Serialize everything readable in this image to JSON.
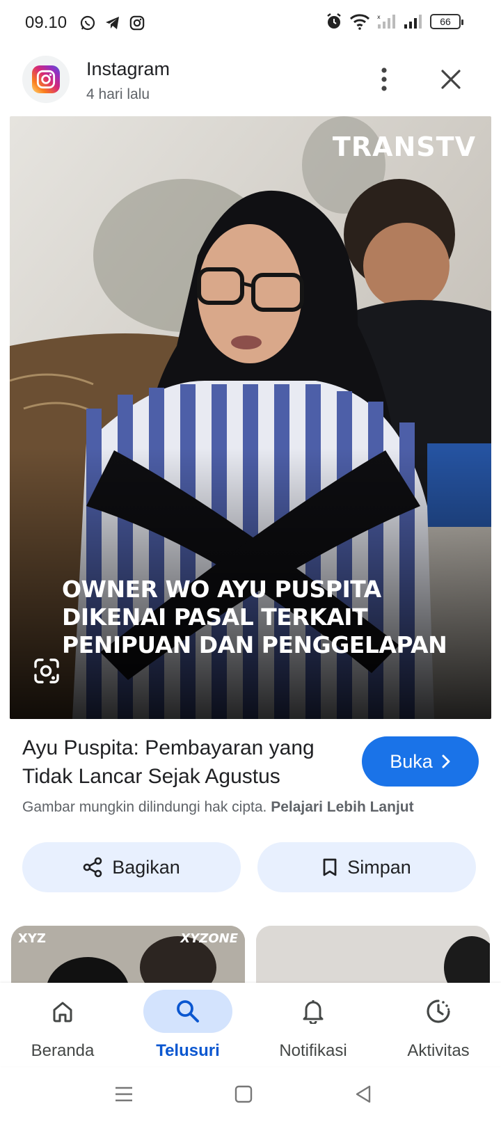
{
  "status_bar": {
    "time": "09.10",
    "battery": "66",
    "left_icons": [
      "whatsapp-icon",
      "telegram-icon",
      "instagram-icon"
    ],
    "right_icons": [
      "alarm-icon",
      "wifi-icon",
      "signal-icon",
      "signal-icon",
      "battery-icon"
    ]
  },
  "header": {
    "source_name": "Instagram",
    "time_ago": "4 hari lalu"
  },
  "image": {
    "watermark": "TRANSTV",
    "caption_lines": [
      "OWNER WO AYU PUSPITA",
      "DIKENAI PASAL TERKAIT",
      "PENIPUAN DAN PENGGELAPAN"
    ]
  },
  "result": {
    "title": "Ayu Puspita: Pembayaran yang Tidak Lancar Sejak Agustus",
    "open_label": "Buka",
    "copyright_text": "Gambar mungkin dilindungi hak cipta.",
    "learn_more": "Pelajari Lebih Lanjut"
  },
  "actions": {
    "share_label": "Bagikan",
    "save_label": "Simpan"
  },
  "related": {
    "thumb1_label_left": "XYZ",
    "thumb1_label_right": "XYZONE"
  },
  "bottom_nav": {
    "items": [
      {
        "label": "Beranda",
        "icon": "home-icon"
      },
      {
        "label": "Telusuri",
        "icon": "search-icon"
      },
      {
        "label": "Notifikasi",
        "icon": "bell-icon"
      },
      {
        "label": "Aktivitas",
        "icon": "activity-icon"
      }
    ],
    "active": "Telusuri"
  },
  "colors": {
    "accent": "#1a73e8",
    "active_nav": "#0b57d0",
    "chip_bg": "#e8f0fe",
    "active_pill": "#d3e3fd"
  }
}
